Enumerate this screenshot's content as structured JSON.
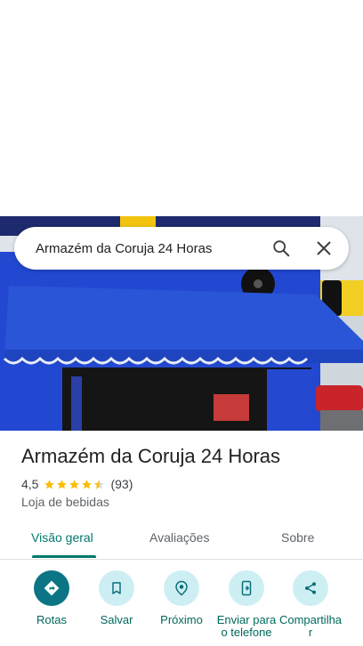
{
  "search": {
    "query": "Armazém da Coruja 24 Horas"
  },
  "photo": {
    "description_colors": {
      "awning": "#2a55d6",
      "wall": "#1d3fbf",
      "interior": "#1a1a1a"
    }
  },
  "place": {
    "title": "Armazém da Coruja 24 Horas",
    "rating": "4,5",
    "rating_stars": 4.5,
    "review_count": "(93)",
    "category": "Loja de bebidas"
  },
  "tabs": [
    {
      "label": "Visão geral",
      "active": true
    },
    {
      "label": "Avaliações",
      "active": false
    },
    {
      "label": "Sobre",
      "active": false
    }
  ],
  "actions": [
    {
      "label": "Rotas",
      "icon": "directions-icon"
    },
    {
      "label": "Salvar",
      "icon": "bookmark-icon"
    },
    {
      "label": "Próximo",
      "icon": "nearby-icon"
    },
    {
      "label": "Enviar para o telefone",
      "icon": "send-to-phone-icon"
    },
    {
      "label": "Compartilhar",
      "icon": "share-icon"
    }
  ],
  "colors": {
    "accent": "#00796b",
    "star": "#fbbc04",
    "action_bg": "#cdeff4",
    "primary_action_bg": "#0b7585"
  }
}
